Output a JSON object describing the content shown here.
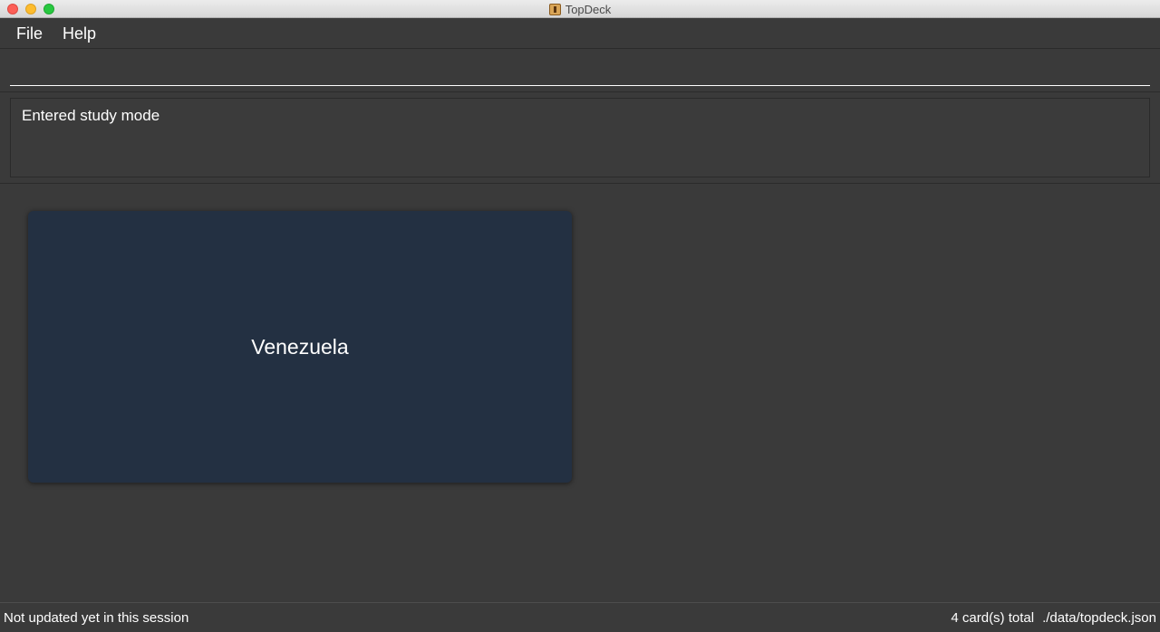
{
  "window": {
    "title": "TopDeck",
    "app_icon": "topdeck-app-icon"
  },
  "menu": {
    "file_label": "File",
    "help_label": "Help"
  },
  "command": {
    "value": "",
    "placeholder": ""
  },
  "result": {
    "message": "Entered study mode"
  },
  "study": {
    "card_text": "Venezuela",
    "card_color": "#233042"
  },
  "status": {
    "sync_text": "Not updated yet in this session",
    "total_cards": "4 card(s) total",
    "file_path": "./data/topdeck.json"
  }
}
